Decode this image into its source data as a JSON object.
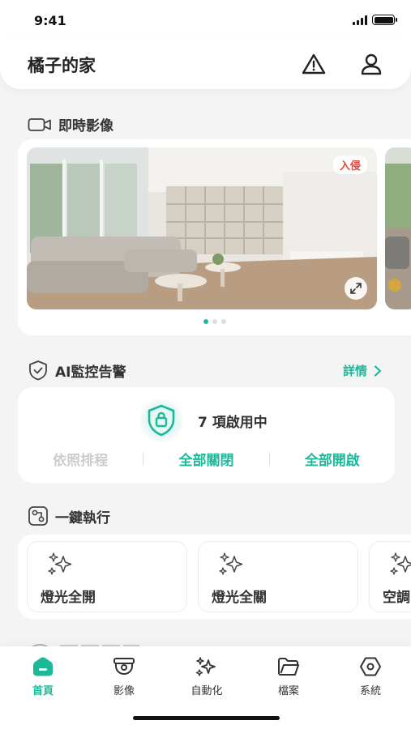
{
  "status_bar": {
    "time": "9:41"
  },
  "header": {
    "home_name": "橘子的家"
  },
  "live": {
    "section_title": "即時影像",
    "badge": "入侵"
  },
  "ai": {
    "section_title": "AI監控告警",
    "detail_link": "詳情",
    "active_text": "7 項啟用中",
    "actions": [
      "依照排程",
      "全部關閉",
      "全部開啟"
    ]
  },
  "oneclick": {
    "section_title": "一鍵執行",
    "scenes": [
      "燈光全開",
      "燈光全關",
      "空調"
    ]
  },
  "tabs": [
    "首頁",
    "影像",
    "自動化",
    "檔案",
    "系統"
  ],
  "colors": {
    "accent": "#1bb99a",
    "alert": "#e2453a",
    "background": "#f4f4f4"
  }
}
